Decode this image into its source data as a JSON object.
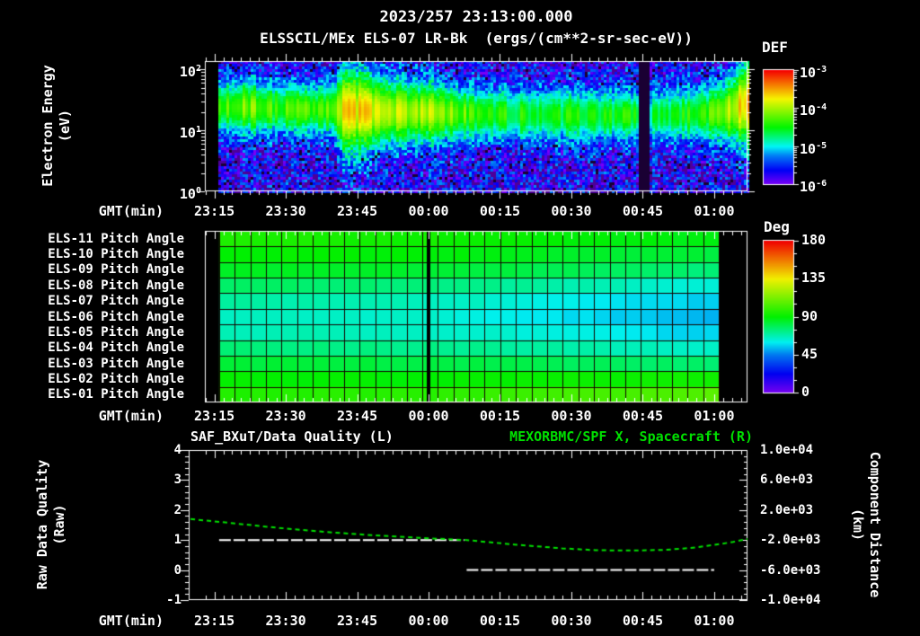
{
  "time_axis": {
    "label": "GMT(min)",
    "tick_labels": [
      "23:15",
      "23:30",
      "23:45",
      "00:00",
      "00:15",
      "00:30",
      "00:45",
      "01:00"
    ],
    "tick_minutes": [
      2,
      17,
      32,
      47,
      62,
      77,
      92,
      107
    ],
    "start_time": "23:13",
    "total_minutes": 114
  },
  "chart_data": [
    {
      "type": "heatmap",
      "datetime": "2023/257 23:13:00.000",
      "title_display": "ELSSCIL/MEx ELS-07 LR-Bk  (ergs/(cm**2-sr-sec-eV))",
      "instrument": "ELSSCIL/MEx ELS-07 LR-Bk",
      "units": "ergs/(cm**2-sr-sec-eV)",
      "xlabel": "GMT(min)",
      "ylabel_lines": [
        "Electron Energy",
        "(eV)"
      ],
      "y_scale": "log",
      "y_tick_exponents": [
        2,
        1,
        0
      ],
      "y_range_ev": [
        1,
        137
      ],
      "colorbar": {
        "title": "DEF",
        "tick_exponents": [
          -3,
          -4,
          -5,
          -6
        ],
        "range_log10": [
          -6,
          -3
        ]
      },
      "background_log10_flux": -5.75,
      "data_start_min": 3,
      "dropout_min": [
        91.3,
        93.2
      ],
      "band": {
        "t_min": [
          3,
          8,
          15,
          22,
          27,
          29,
          33,
          36,
          40,
          47,
          52,
          58,
          65,
          75,
          85,
          91,
          92.5,
          94,
          100,
          106,
          110,
          114
        ],
        "peak_log10_flux": [
          -4.25,
          -4.15,
          -4.3,
          -4.35,
          -4.2,
          -3.75,
          -3.7,
          -3.9,
          -3.95,
          -4.0,
          -4.15,
          -4.35,
          -4.5,
          -4.5,
          -4.45,
          -4.5,
          -5.4,
          -4.7,
          -4.5,
          -4.3,
          -4.0,
          -3.55
        ],
        "center_log10_ev": [
          1.38,
          1.38,
          1.36,
          1.35,
          1.34,
          1.33,
          1.32,
          1.31,
          1.3,
          1.3,
          1.28,
          1.27,
          1.26,
          1.25,
          1.25,
          1.25,
          1.25,
          1.25,
          1.26,
          1.28,
          1.32,
          1.45
        ],
        "width_decades": [
          0.3,
          0.32,
          0.3,
          0.28,
          0.3,
          0.5,
          0.48,
          0.42,
          0.38,
          0.36,
          0.33,
          0.3,
          0.3,
          0.3,
          0.3,
          0.28,
          0.28,
          0.28,
          0.3,
          0.32,
          0.38,
          0.5
        ]
      }
    },
    {
      "type": "heatmap",
      "colorbar": {
        "title": "Deg",
        "ticks": [
          180,
          135,
          90,
          45,
          0
        ],
        "range_deg": [
          0,
          180
        ]
      },
      "t_control_min": [
        3,
        47,
        108
      ],
      "data_start_min": 3,
      "data_end_min": 108,
      "gap_at_min": 47,
      "columns": 32,
      "rows": [
        {
          "label": "ELS-11 Pitch Angle",
          "deg_at_t": [
            95,
            93,
            87
          ]
        },
        {
          "label": "ELS-10 Pitch Angle",
          "deg_at_t": [
            91,
            89,
            82
          ]
        },
        {
          "label": "ELS-09 Pitch Angle",
          "deg_at_t": [
            86,
            84,
            75
          ]
        },
        {
          "label": "ELS-08 Pitch Angle",
          "deg_at_t": [
            78,
            75,
            62
          ]
        },
        {
          "label": "ELS-07 Pitch Angle",
          "deg_at_t": [
            70,
            67,
            55
          ]
        },
        {
          "label": "ELS-06 Pitch Angle",
          "deg_at_t": [
            66,
            64,
            52
          ]
        },
        {
          "label": "ELS-05 Pitch Angle",
          "deg_at_t": [
            68,
            66,
            56
          ]
        },
        {
          "label": "ELS-04 Pitch Angle",
          "deg_at_t": [
            75,
            73,
            65
          ]
        },
        {
          "label": "ELS-03 Pitch Angle",
          "deg_at_t": [
            83,
            82,
            76
          ]
        },
        {
          "label": "ELS-02 Pitch Angle",
          "deg_at_t": [
            90,
            90,
            93
          ]
        },
        {
          "label": "ELS-01 Pitch Angle",
          "deg_at_t": [
            96,
            98,
            106
          ]
        }
      ]
    },
    {
      "type": "line",
      "title_left": "SAF_BXuT/Data Quality (L)",
      "title_right": "MEXORBMC/SPF X, Spacecraft (R)",
      "title_right_color": "#00e000",
      "left_axis": {
        "label_lines": [
          "Raw Data Quality",
          "(Raw)"
        ],
        "ticks": [
          4,
          3,
          2,
          1,
          0,
          -1
        ],
        "range": [
          -1,
          4
        ]
      },
      "right_axis": {
        "label_lines": [
          "Component Distance",
          "(km)"
        ],
        "tick_labels": [
          "1.0e+04",
          "6.0e+03",
          "2.0e+03",
          "-2.0e+03",
          "-6.0e+03",
          "-1.0e+04"
        ],
        "range": [
          -10000,
          10000
        ]
      },
      "series": [
        {
          "name": "SAF_BXuT/Data Quality (L)",
          "axis": "left",
          "color": "#ffffff",
          "style": "dashed",
          "segments": [
            {
              "value": 1,
              "t_min": [
                3,
                54.5
              ]
            },
            {
              "value": 0,
              "t_min": [
                55,
                107
              ]
            }
          ]
        },
        {
          "name": "MEXORBMC/SPF X, Spacecraft (R)",
          "axis": "right",
          "color": "#00e000",
          "style": "dashed",
          "points_t_km": [
            [
              -3,
              800
            ],
            [
              5,
              300
            ],
            [
              15,
              -350
            ],
            [
              25,
              -900
            ],
            [
              35,
              -1350
            ],
            [
              45,
              -1700
            ],
            [
              55,
              -2000
            ],
            [
              65,
              -2600
            ],
            [
              75,
              -3100
            ],
            [
              82,
              -3350
            ],
            [
              90,
              -3400
            ],
            [
              97,
              -3300
            ],
            [
              103,
              -3000
            ],
            [
              108,
              -2550
            ],
            [
              111,
              -2250
            ],
            [
              114,
              -1850
            ]
          ]
        }
      ]
    }
  ]
}
